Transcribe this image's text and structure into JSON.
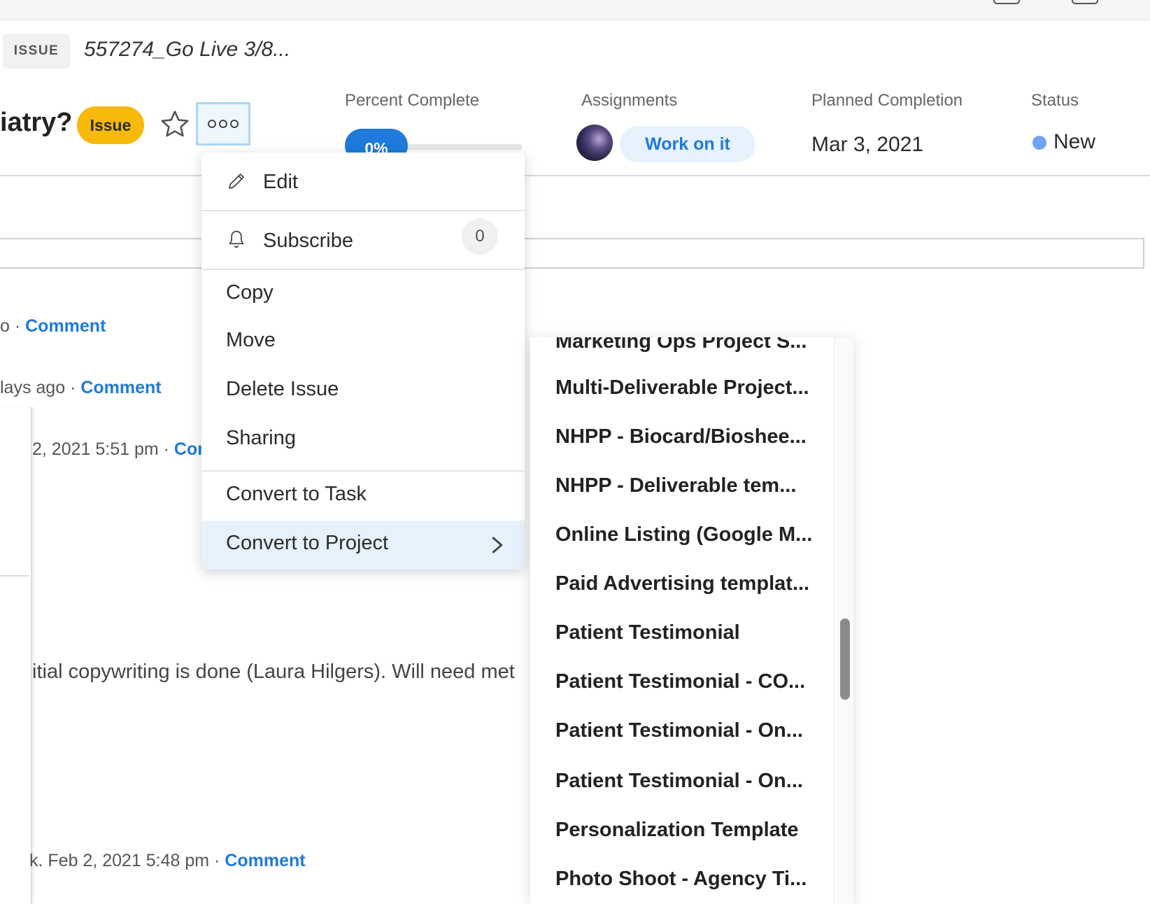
{
  "header": {
    "type_chip": "ISSUE",
    "breadcrumb": "557274_Go Live 3/8...",
    "title": "iatry?",
    "type_badge": "Issue"
  },
  "meta": {
    "percent_label": "Percent Complete",
    "percent_value": "0%",
    "percent_fraction": 0,
    "assignments_label": "Assignments",
    "work_on_it": "Work on it",
    "planned_label": "Planned Completion",
    "planned_value": "Mar 3, 2021",
    "status_label": "Status",
    "status_value": "New"
  },
  "activity": [
    {
      "prefix": "o · ",
      "link": "Comment"
    },
    {
      "prefix": "lays ago · ",
      "link": "Comment"
    },
    {
      "prefix": "2, 2021 5:51 pm · ",
      "link": "Cor"
    },
    {
      "body": "itial copywriting is done (Laura Hilgers). Will need met"
    },
    {
      "prefix": "k. Feb 2, 2021 5:48 pm · ",
      "link": "Comment"
    }
  ],
  "menu": {
    "edit": "Edit",
    "subscribe": "Subscribe",
    "subscribe_count": "0",
    "copy": "Copy",
    "move": "Move",
    "delete": "Delete Issue",
    "sharing": "Sharing",
    "convert_task": "Convert to Task",
    "convert_project": "Convert to Project"
  },
  "submenu": {
    "items": [
      "Marketing Ops Project S...",
      "Multi-Deliverable Project...",
      "NHPP - Biocard/Bioshee...",
      "NHPP - Deliverable tem...",
      "Online Listing (Google M...",
      "Paid Advertising templat...",
      "Patient Testimonial",
      "Patient Testimonial - CO...",
      "Patient Testimonial - On...",
      "Patient Testimonial - On...",
      "Personalization Template",
      "Photo Shoot - Agency Ti..."
    ]
  },
  "colors": {
    "accent": "#1f7adb",
    "badge": "#f6b90c",
    "status_new": "#6fa3f5"
  }
}
